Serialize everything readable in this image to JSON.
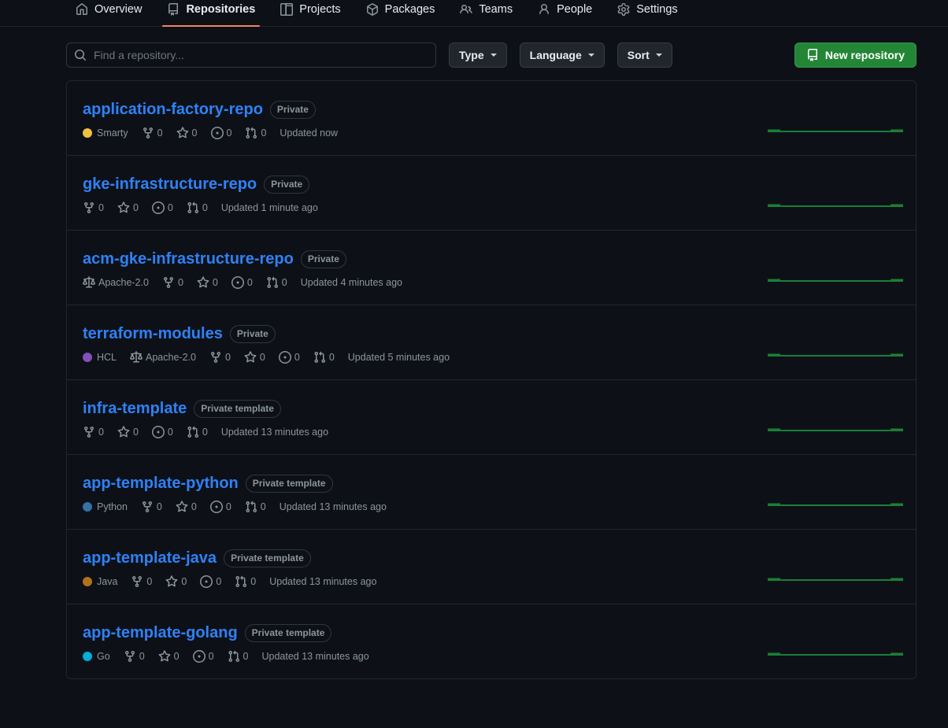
{
  "nav": {
    "items": [
      {
        "label": "Overview",
        "icon": "home-icon",
        "selected": false
      },
      {
        "label": "Repositories",
        "icon": "repo-icon",
        "selected": true
      },
      {
        "label": "Projects",
        "icon": "project-icon",
        "selected": false
      },
      {
        "label": "Packages",
        "icon": "package-icon",
        "selected": false
      },
      {
        "label": "Teams",
        "icon": "people-icon",
        "selected": false
      },
      {
        "label": "People",
        "icon": "person-icon",
        "selected": false
      },
      {
        "label": "Settings",
        "icon": "gear-icon",
        "selected": false
      }
    ],
    "selected_indicator_color": "#f78166"
  },
  "toolbar": {
    "search_placeholder": "Find a repository...",
    "search_value": "",
    "filters": [
      {
        "label": "Type"
      },
      {
        "label": "Language"
      },
      {
        "label": "Sort"
      }
    ],
    "new_repository_label": "New repository",
    "new_repository_color": "#238636"
  },
  "repositories": [
    {
      "name": "application-factory-repo",
      "visibility": "Private",
      "language": "Smarty",
      "language_color": "#f0c040",
      "license": "",
      "forks": "0",
      "stars": "0",
      "issues": "0",
      "pulls": "0",
      "updated": "Updated now"
    },
    {
      "name": "gke-infrastructure-repo",
      "visibility": "Private",
      "language": "",
      "language_color": "",
      "license": "",
      "forks": "0",
      "stars": "0",
      "issues": "0",
      "pulls": "0",
      "updated": "Updated 1 minute ago"
    },
    {
      "name": "acm-gke-infrastructure-repo",
      "visibility": "Private",
      "language": "",
      "language_color": "",
      "license": "Apache-2.0",
      "forks": "0",
      "stars": "0",
      "issues": "0",
      "pulls": "0",
      "updated": "Updated 4 minutes ago"
    },
    {
      "name": "terraform-modules",
      "visibility": "Private",
      "language": "HCL",
      "language_color": "#844FBA",
      "license": "Apache-2.0",
      "forks": "0",
      "stars": "0",
      "issues": "0",
      "pulls": "0",
      "updated": "Updated 5 minutes ago"
    },
    {
      "name": "infra-template",
      "visibility": "Private template",
      "language": "",
      "language_color": "",
      "license": "",
      "forks": "0",
      "stars": "0",
      "issues": "0",
      "pulls": "0",
      "updated": "Updated 13 minutes ago"
    },
    {
      "name": "app-template-python",
      "visibility": "Private template",
      "language": "Python",
      "language_color": "#3572A5",
      "license": "",
      "forks": "0",
      "stars": "0",
      "issues": "0",
      "pulls": "0",
      "updated": "Updated 13 minutes ago"
    },
    {
      "name": "app-template-java",
      "visibility": "Private template",
      "language": "Java",
      "language_color": "#b07219",
      "license": "",
      "forks": "0",
      "stars": "0",
      "issues": "0",
      "pulls": "0",
      "updated": "Updated 13 minutes ago"
    },
    {
      "name": "app-template-golang",
      "visibility": "Private template",
      "language": "Go",
      "language_color": "#00ADD8",
      "license": "",
      "forks": "0",
      "stars": "0",
      "issues": "0",
      "pulls": "0",
      "updated": "Updated 13 minutes ago"
    }
  ],
  "activity_graph": {
    "color": "#1a7f37",
    "description": "flat-activity-sparkline"
  }
}
